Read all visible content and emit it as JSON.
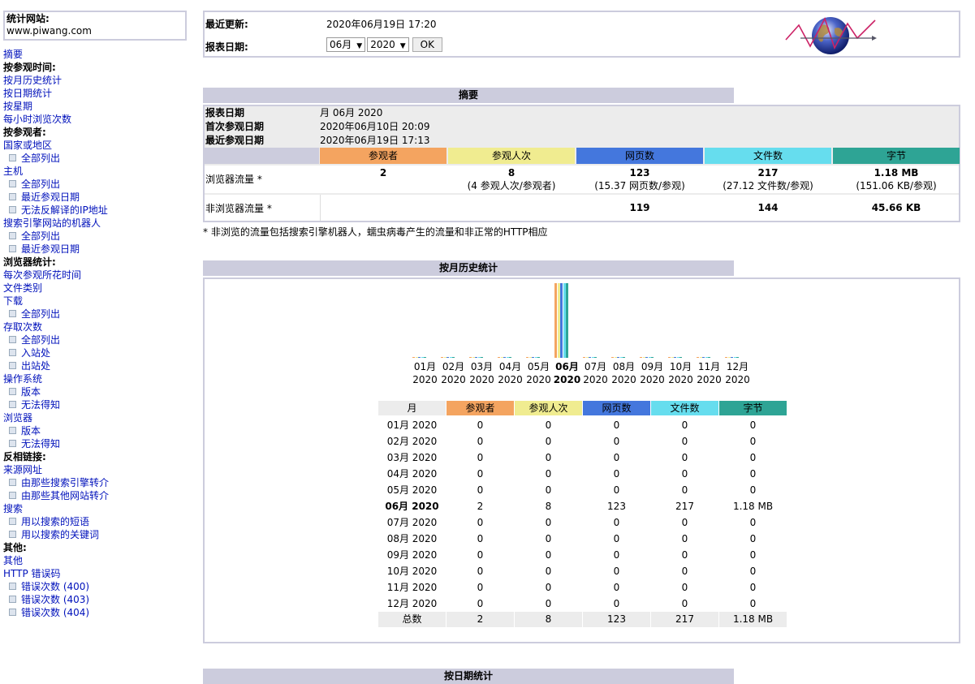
{
  "menu": {
    "site_label": "统计网站:",
    "site_value": "www.piwang.com",
    "items": [
      {
        "label": "摘要",
        "type": "link"
      },
      {
        "label": "按参观时间:",
        "type": "bold"
      },
      {
        "label": "按月历史统计",
        "type": "link"
      },
      {
        "label": "按日期统计",
        "type": "link"
      },
      {
        "label": "按星期",
        "type": "link"
      },
      {
        "label": "每小时浏览次数",
        "type": "link"
      },
      {
        "label": "按参观者:",
        "type": "bold"
      },
      {
        "label": "国家或地区",
        "type": "link"
      },
      {
        "label": "全部列出",
        "type": "sub"
      },
      {
        "label": "主机",
        "type": "link"
      },
      {
        "label": "全部列出",
        "type": "sub"
      },
      {
        "label": "最近参观日期",
        "type": "sub"
      },
      {
        "label": "无法反解译的IP地址",
        "type": "sub"
      },
      {
        "label": "搜索引擎网站的机器人",
        "type": "link"
      },
      {
        "label": "全部列出",
        "type": "sub"
      },
      {
        "label": "最近参观日期",
        "type": "sub"
      },
      {
        "label": "浏览器统计:",
        "type": "bold"
      },
      {
        "label": "每次参观所花时间",
        "type": "link"
      },
      {
        "label": "文件类别",
        "type": "link"
      },
      {
        "label": "下载",
        "type": "link"
      },
      {
        "label": "全部列出",
        "type": "sub"
      },
      {
        "label": "存取次数",
        "type": "link"
      },
      {
        "label": "全部列出",
        "type": "sub"
      },
      {
        "label": "入站处",
        "type": "sub"
      },
      {
        "label": "出站处",
        "type": "sub"
      },
      {
        "label": "操作系统",
        "type": "link"
      },
      {
        "label": "版本",
        "type": "sub"
      },
      {
        "label": "无法得知",
        "type": "sub"
      },
      {
        "label": "浏览器",
        "type": "link"
      },
      {
        "label": "版本",
        "type": "sub"
      },
      {
        "label": "无法得知",
        "type": "sub"
      },
      {
        "label": "反相链接:",
        "type": "bold"
      },
      {
        "label": "来源网址",
        "type": "link"
      },
      {
        "label": "由那些搜索引擎转介",
        "type": "sub"
      },
      {
        "label": "由那些其他网站转介",
        "type": "sub"
      },
      {
        "label": "搜索",
        "type": "link"
      },
      {
        "label": "用以搜索的短语",
        "type": "sub"
      },
      {
        "label": "用以搜索的关键词",
        "type": "sub"
      },
      {
        "label": "其他:",
        "type": "bold"
      },
      {
        "label": "其他",
        "type": "link"
      },
      {
        "label": "HTTP 错误码",
        "type": "link"
      },
      {
        "label": "错误次数 (400)",
        "type": "sub"
      },
      {
        "label": "错误次数 (403)",
        "type": "sub"
      },
      {
        "label": "错误次数 (404)",
        "type": "sub"
      }
    ]
  },
  "header": {
    "last_update_label": "最近更新:",
    "last_update_value": "2020年06月19日 17:20",
    "report_date_label": "报表日期:",
    "month_select": "06月",
    "year_select": "2020",
    "ok_label": "OK",
    "logo_icon": "awstats-globe-icon"
  },
  "summary": {
    "title": "摘要",
    "rows": [
      {
        "k": "报表日期",
        "v": "月 06月 2020"
      },
      {
        "k": "首次参观日期",
        "v": "2020年06月10日 20:09"
      },
      {
        "k": "最近参观日期",
        "v": "2020年06月19日 17:13"
      }
    ],
    "headers": [
      "参观者",
      "参观人次",
      "网页数",
      "文件数",
      "字节"
    ],
    "browser_label": "浏览器流量 *",
    "browser": [
      {
        "n": "2",
        "s": ""
      },
      {
        "n": "8",
        "s": "(4 参观人次/参观者)"
      },
      {
        "n": "123",
        "s": "(15.37 网页数/参观)"
      },
      {
        "n": "217",
        "s": "(27.12 文件数/参观)"
      },
      {
        "n": "1.18 MB",
        "s": "(151.06 KB/参观)"
      }
    ],
    "nonbrowser_label": "非浏览器流量 *",
    "nonbrowser": [
      "",
      "",
      "119",
      "144",
      "45.66 KB"
    ],
    "footnote": "* 非浏览的流量包括搜索引擎机器人，蠕虫病毒产生的流量和非正常的HTTP相应"
  },
  "monthly": {
    "title": "按月历史统计",
    "col_month": "月",
    "headers": [
      "参观者",
      "参观人次",
      "网页数",
      "文件数",
      "字节"
    ],
    "months": [
      "01月",
      "02月",
      "03月",
      "04月",
      "05月",
      "06月",
      "07月",
      "08月",
      "09月",
      "10月",
      "11月",
      "12月"
    ],
    "year": "2020",
    "current_index": 5,
    "rows": [
      [
        "01月 2020",
        "0",
        "0",
        "0",
        "0",
        "0"
      ],
      [
        "02月 2020",
        "0",
        "0",
        "0",
        "0",
        "0"
      ],
      [
        "03月 2020",
        "0",
        "0",
        "0",
        "0",
        "0"
      ],
      [
        "04月 2020",
        "0",
        "0",
        "0",
        "0",
        "0"
      ],
      [
        "05月 2020",
        "0",
        "0",
        "0",
        "0",
        "0"
      ],
      [
        "06月 2020",
        "2",
        "8",
        "123",
        "217",
        "1.18 MB"
      ],
      [
        "07月 2020",
        "0",
        "0",
        "0",
        "0",
        "0"
      ],
      [
        "08月 2020",
        "0",
        "0",
        "0",
        "0",
        "0"
      ],
      [
        "09月 2020",
        "0",
        "0",
        "0",
        "0",
        "0"
      ],
      [
        "10月 2020",
        "0",
        "0",
        "0",
        "0",
        "0"
      ],
      [
        "11月 2020",
        "0",
        "0",
        "0",
        "0",
        "0"
      ],
      [
        "12月 2020",
        "0",
        "0",
        "0",
        "0",
        "0"
      ]
    ],
    "total": [
      "总数",
      "2",
      "8",
      "123",
      "217",
      "1.18 MB"
    ]
  },
  "chart_data": {
    "type": "bar",
    "categories": [
      "01月 2020",
      "02月 2020",
      "03月 2020",
      "04月 2020",
      "05月 2020",
      "06月 2020",
      "07月 2020",
      "08月 2020",
      "09月 2020",
      "10月 2020",
      "11月 2020",
      "12月 2020"
    ],
    "series": [
      {
        "name": "参观者",
        "values": [
          0,
          0,
          0,
          0,
          0,
          2,
          0,
          0,
          0,
          0,
          0,
          0
        ]
      },
      {
        "name": "参观人次",
        "values": [
          0,
          0,
          0,
          0,
          0,
          8,
          0,
          0,
          0,
          0,
          0,
          0
        ]
      },
      {
        "name": "网页数",
        "values": [
          0,
          0,
          0,
          0,
          0,
          123,
          0,
          0,
          0,
          0,
          0,
          0
        ]
      },
      {
        "name": "文件数",
        "values": [
          0,
          0,
          0,
          0,
          0,
          217,
          0,
          0,
          0,
          0,
          0,
          0
        ]
      },
      {
        "name": "字节",
        "values": [
          0,
          0,
          0,
          0,
          0,
          1.18,
          0,
          0,
          0,
          0,
          0,
          0
        ]
      }
    ],
    "colors": [
      "#F4A460",
      "#F0EC90",
      "#4477DD",
      "#66DDEE",
      "#2EA495"
    ]
  },
  "daily": {
    "title": "按日期统计"
  }
}
